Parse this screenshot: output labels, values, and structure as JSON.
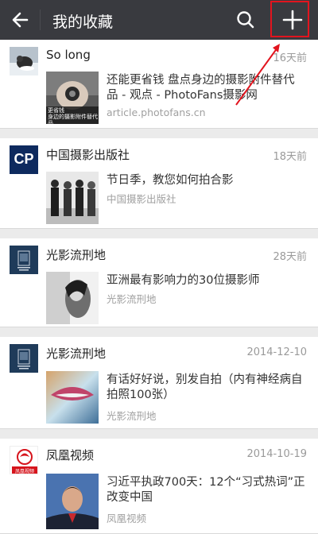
{
  "header": {
    "title": "我的收藏",
    "back_icon": "back-arrow-icon",
    "search_icon": "search-icon",
    "add_icon": "plus-icon",
    "bar_color": "#393a3f",
    "highlight_color": "#e2141e"
  },
  "favorites": [
    {
      "author": "So long",
      "time": "16天前",
      "headline": "还能更省钱 盘点身边的摄影附件替代品 - 观点 - PhotoFans摄影网",
      "source": "article.photofans.cn",
      "thumb_caption": "更省钱\n身边的摄影附件替代品"
    },
    {
      "author": "中国摄影出版社",
      "time": "18天前",
      "headline": "节日季，教您如何拍合影",
      "source": "中国摄影出版社",
      "avatar_text": "CP"
    },
    {
      "author": "光影流刑地",
      "time": "28天前",
      "headline": "亚洲最有影响力的30位摄影师",
      "source": "光影流刑地"
    },
    {
      "author": "光影流刑地",
      "time": "2014-12-10",
      "headline": "有话好好说，别发自拍（内有神经病自拍照100张）",
      "source": "光影流刑地"
    },
    {
      "author": "凤凰视频",
      "time": "2014-10-19",
      "headline": "习近平执政700天：12个“习式热词”正改变中国",
      "source": "凤凰视频",
      "avatar_text": "凤凰视频"
    }
  ]
}
